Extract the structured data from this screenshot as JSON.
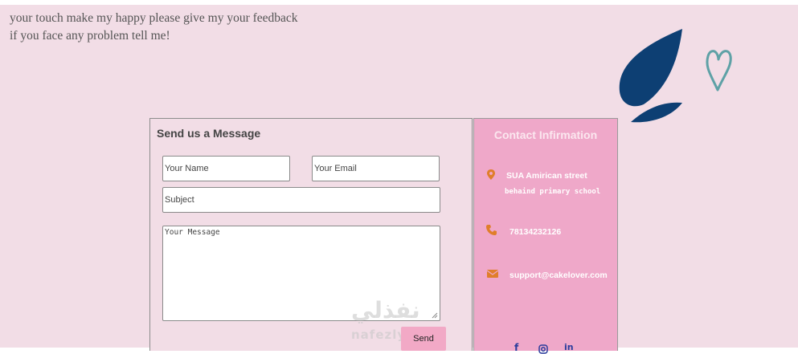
{
  "intro": {
    "line1": "your touch make my happy please give my your feedback",
    "line2": "if you face any problem tell me!"
  },
  "form": {
    "title": "Send us a Message",
    "name_placeholder": "Your Name",
    "email_placeholder": "Your Email",
    "subject_placeholder": "Subject",
    "message_placeholder": "Your Message",
    "send_label": "Send"
  },
  "contact": {
    "title": "Contact Infirmation",
    "address_line1": "SUA Amirican street",
    "address_line2": "behaind primary school",
    "phone": "78134232126",
    "email": "support@cakelover.com",
    "icons": [
      "location-icon",
      "phone-icon",
      "envelope-icon"
    ],
    "social": [
      "facebook-icon",
      "instagram-icon",
      "linkedin-icon"
    ]
  },
  "watermark": {
    "line1": "نفذلي",
    "line2": "nafezly.com"
  },
  "colors": {
    "page_bg": "#f2dde6",
    "contact_bg": "#efa8c9",
    "leaf": "#0d3f73",
    "heart": "#5ea1a6",
    "icon_accent": "#e07e2a",
    "button": "#f2a9c6"
  }
}
